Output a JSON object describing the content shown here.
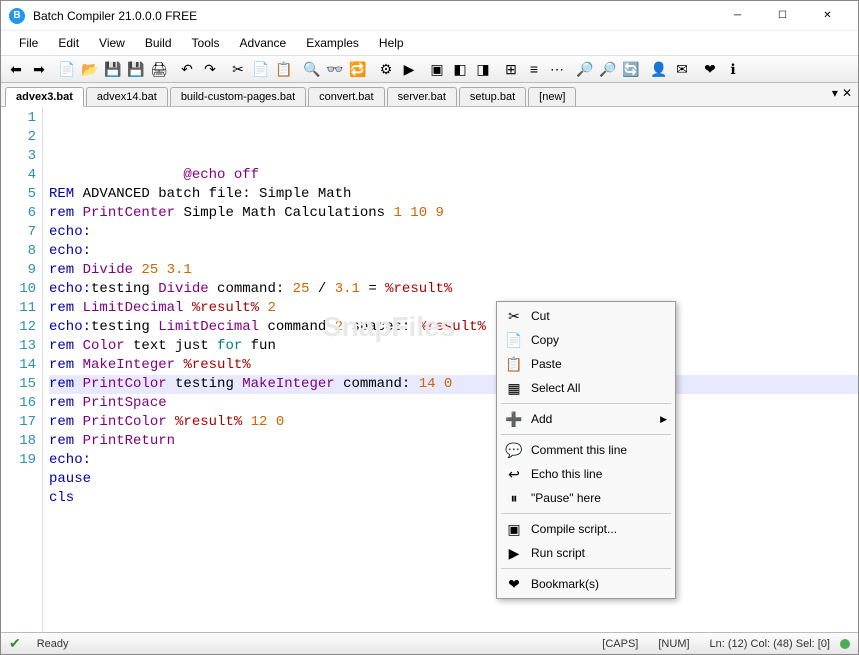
{
  "window": {
    "title": "Batch Compiler 21.0.0.0 FREE"
  },
  "menu": [
    "File",
    "Edit",
    "View",
    "Build",
    "Tools",
    "Advance",
    "Examples",
    "Help"
  ],
  "tabs": [
    "advex3.bat",
    "advex14.bat",
    "build-custom-pages.bat",
    "convert.bat",
    "server.bat",
    "setup.bat",
    "[new]"
  ],
  "activeTab": 0,
  "code": {
    "lines": [
      {
        "n": 1,
        "tokens": [
          {
            "t": "                @echo off",
            "c": "kw-cmd"
          }
        ]
      },
      {
        "n": 2,
        "tokens": [
          {
            "t": "REM ",
            "c": "kw-rem"
          },
          {
            "t": "ADVANCED batch file: Simple Math",
            "c": ""
          }
        ]
      },
      {
        "n": 3,
        "tokens": [
          {
            "t": "rem ",
            "c": "kw-rem"
          },
          {
            "t": "PrintCenter ",
            "c": "kw-cmd"
          },
          {
            "t": "Simple Math Calculations ",
            "c": ""
          },
          {
            "t": "1 10 9",
            "c": "kw-num"
          }
        ]
      },
      {
        "n": 4,
        "tokens": [
          {
            "t": "echo:",
            "c": "kw-echo"
          }
        ]
      },
      {
        "n": 5,
        "tokens": [
          {
            "t": "echo:",
            "c": "kw-echo"
          }
        ]
      },
      {
        "n": 6,
        "tokens": [
          {
            "t": "rem ",
            "c": "kw-rem"
          },
          {
            "t": "Divide ",
            "c": "kw-cmd"
          },
          {
            "t": "25 3.1",
            "c": "kw-num"
          }
        ]
      },
      {
        "n": 7,
        "tokens": [
          {
            "t": "echo:",
            "c": "kw-echo"
          },
          {
            "t": "testing ",
            "c": ""
          },
          {
            "t": "Divide ",
            "c": "kw-cmd"
          },
          {
            "t": "command: ",
            "c": ""
          },
          {
            "t": "25 ",
            "c": "kw-num"
          },
          {
            "t": "/ ",
            "c": ""
          },
          {
            "t": "3.1 ",
            "c": "kw-num"
          },
          {
            "t": "= ",
            "c": ""
          },
          {
            "t": "%result%",
            "c": "kw-var"
          }
        ]
      },
      {
        "n": 8,
        "tokens": [
          {
            "t": "rem ",
            "c": "kw-rem"
          },
          {
            "t": "LimitDecimal ",
            "c": "kw-cmd"
          },
          {
            "t": "%result% ",
            "c": "kw-var"
          },
          {
            "t": "2",
            "c": "kw-num"
          }
        ]
      },
      {
        "n": 9,
        "tokens": [
          {
            "t": "echo:",
            "c": "kw-echo"
          },
          {
            "t": "testing ",
            "c": ""
          },
          {
            "t": "LimitDecimal ",
            "c": "kw-cmd"
          },
          {
            "t": "command ",
            "c": ""
          },
          {
            "t": "2 ",
            "c": "kw-num"
          },
          {
            "t": "spaces: ",
            "c": ""
          },
          {
            "t": "%result%",
            "c": "kw-var"
          }
        ]
      },
      {
        "n": 10,
        "tokens": [
          {
            "t": "rem ",
            "c": "kw-rem"
          },
          {
            "t": "Color ",
            "c": "kw-cmd"
          },
          {
            "t": "text just ",
            "c": ""
          },
          {
            "t": "for ",
            "c": "kw-cmd2"
          },
          {
            "t": "fun",
            "c": ""
          }
        ]
      },
      {
        "n": 11,
        "tokens": [
          {
            "t": "rem ",
            "c": "kw-rem"
          },
          {
            "t": "MakeInteger ",
            "c": "kw-cmd"
          },
          {
            "t": "%result%",
            "c": "kw-var"
          }
        ]
      },
      {
        "n": 12,
        "hl": true,
        "tokens": [
          {
            "t": "rem ",
            "c": "kw-rem"
          },
          {
            "t": "PrintColor ",
            "c": "kw-cmd"
          },
          {
            "t": "testing ",
            "c": ""
          },
          {
            "t": "MakeInteger ",
            "c": "kw-cmd"
          },
          {
            "t": "command: ",
            "c": ""
          },
          {
            "t": "14 0",
            "c": "kw-num"
          }
        ]
      },
      {
        "n": 13,
        "tokens": [
          {
            "t": "rem ",
            "c": "kw-rem"
          },
          {
            "t": "PrintSpace",
            "c": "kw-cmd"
          }
        ]
      },
      {
        "n": 14,
        "tokens": [
          {
            "t": "rem ",
            "c": "kw-rem"
          },
          {
            "t": "PrintColor ",
            "c": "kw-cmd"
          },
          {
            "t": "%result% ",
            "c": "kw-var"
          },
          {
            "t": "12 0",
            "c": "kw-num"
          }
        ]
      },
      {
        "n": 15,
        "tokens": [
          {
            "t": "rem ",
            "c": "kw-rem"
          },
          {
            "t": "PrintReturn",
            "c": "kw-cmd"
          }
        ]
      },
      {
        "n": 16,
        "tokens": [
          {
            "t": "echo:",
            "c": "kw-echo"
          }
        ]
      },
      {
        "n": 17,
        "tokens": [
          {
            "t": "pause",
            "c": "kw-echo"
          }
        ]
      },
      {
        "n": 18,
        "tokens": [
          {
            "t": "cls",
            "c": "kw-echo"
          }
        ]
      },
      {
        "n": 19,
        "tokens": []
      }
    ]
  },
  "contextMenu": [
    {
      "icon": "✂",
      "label": "Cut",
      "name": "cut"
    },
    {
      "icon": "📄",
      "label": "Copy",
      "name": "copy"
    },
    {
      "icon": "📋",
      "label": "Paste",
      "name": "paste"
    },
    {
      "icon": "▦",
      "label": "Select All",
      "name": "select-all"
    },
    {
      "sep": true
    },
    {
      "icon": "➕",
      "label": "Add",
      "name": "add",
      "sub": true
    },
    {
      "sep": true
    },
    {
      "icon": "💬",
      "label": "Comment this line",
      "name": "comment-line"
    },
    {
      "icon": "↩",
      "label": "Echo this line",
      "name": "echo-line"
    },
    {
      "icon": "⏸",
      "label": "\"Pause\" here",
      "name": "pause-here"
    },
    {
      "sep": true
    },
    {
      "icon": "▣",
      "label": "Compile script...",
      "name": "compile-script"
    },
    {
      "icon": "▶",
      "label": "Run script",
      "name": "run-script"
    },
    {
      "sep": true
    },
    {
      "icon": "❤",
      "label": "Bookmark(s)",
      "name": "bookmarks"
    }
  ],
  "toolbarIcons": [
    {
      "g": "⬅",
      "n": "back"
    },
    {
      "g": "➡",
      "n": "forward"
    },
    {
      "sep": true
    },
    {
      "g": "📄",
      "n": "new-file"
    },
    {
      "g": "📂",
      "n": "open"
    },
    {
      "g": "💾",
      "n": "save"
    },
    {
      "g": "💾",
      "n": "save-all"
    },
    {
      "g": "🖨",
      "n": "print"
    },
    {
      "sep": true
    },
    {
      "g": "↶",
      "n": "undo"
    },
    {
      "g": "↷",
      "n": "redo"
    },
    {
      "sep": true
    },
    {
      "g": "✂",
      "n": "cut"
    },
    {
      "g": "📄",
      "n": "copy"
    },
    {
      "g": "📋",
      "n": "paste"
    },
    {
      "sep": true
    },
    {
      "g": "🔍",
      "n": "find"
    },
    {
      "g": "👓",
      "n": "find-next"
    },
    {
      "g": "🔁",
      "n": "replace"
    },
    {
      "sep": true
    },
    {
      "g": "⚙",
      "n": "compile"
    },
    {
      "g": "▶",
      "n": "run"
    },
    {
      "sep": true
    },
    {
      "g": "▣",
      "n": "build"
    },
    {
      "g": "◧",
      "n": "panel1"
    },
    {
      "g": "◨",
      "n": "panel2"
    },
    {
      "sep": true
    },
    {
      "g": "⊞",
      "n": "grid"
    },
    {
      "g": "≡",
      "n": "wrap"
    },
    {
      "g": "⋯",
      "n": "whitespace"
    },
    {
      "sep": true
    },
    {
      "g": "🔎",
      "n": "zoom-in"
    },
    {
      "g": "🔎",
      "n": "zoom-out"
    },
    {
      "g": "🔄",
      "n": "zoom-reset"
    },
    {
      "sep": true
    },
    {
      "g": "👤",
      "n": "user"
    },
    {
      "g": "✉",
      "n": "mail"
    },
    {
      "sep": true
    },
    {
      "g": "❤",
      "n": "bookmark"
    },
    {
      "g": "ℹ",
      "n": "about"
    }
  ],
  "status": {
    "ready": "Ready",
    "caps": "[CAPS]",
    "num": "[NUM]",
    "pos": "Ln:  (12)  Col:  (48)  Sel:  [0]"
  }
}
